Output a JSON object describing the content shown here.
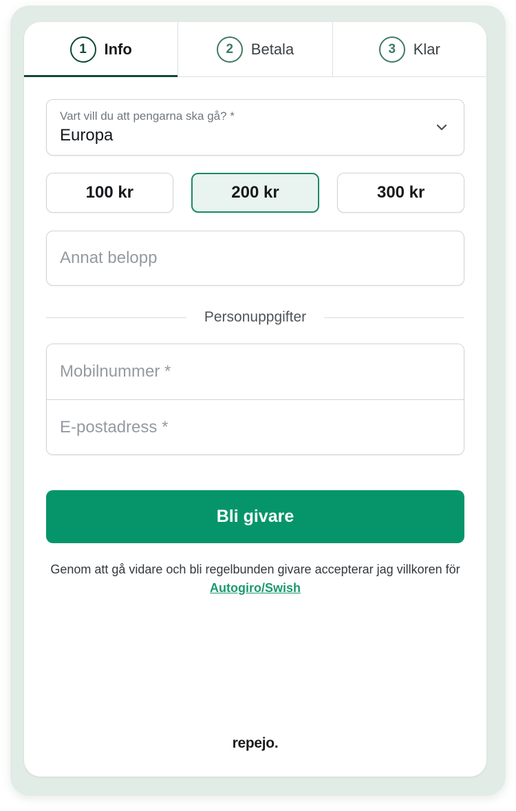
{
  "tabs": [
    {
      "number": "1",
      "label": "Info",
      "active": true
    },
    {
      "number": "2",
      "label": "Betala",
      "active": false
    },
    {
      "number": "3",
      "label": "Klar",
      "active": false
    }
  ],
  "destination": {
    "label": "Vart vill du att pengarna ska gå? *",
    "value": "Europa",
    "icon": "chevron-down-icon"
  },
  "amounts": [
    {
      "label": "100 kr",
      "selected": false
    },
    {
      "label": "200 kr",
      "selected": true
    },
    {
      "label": "300 kr",
      "selected": false
    }
  ],
  "other_amount": {
    "placeholder": "Annat belopp",
    "value": ""
  },
  "section_divider": "Personuppgifter",
  "personal": {
    "mobile_placeholder": "Mobilnummer *",
    "email_placeholder": "E-postadress *"
  },
  "submit_label": "Bli givare",
  "terms": {
    "text": "Genom att gå vidare och bli regelbunden givare accepterar jag villkoren för ",
    "link": "Autogiro/Swish"
  },
  "brand": "repejo.",
  "colors": {
    "accent": "#06956a",
    "tab_active": "#0c4a36",
    "selected_bg": "#e9f3ef",
    "link": "#1a9a6e",
    "frame": "#e2ece7"
  }
}
